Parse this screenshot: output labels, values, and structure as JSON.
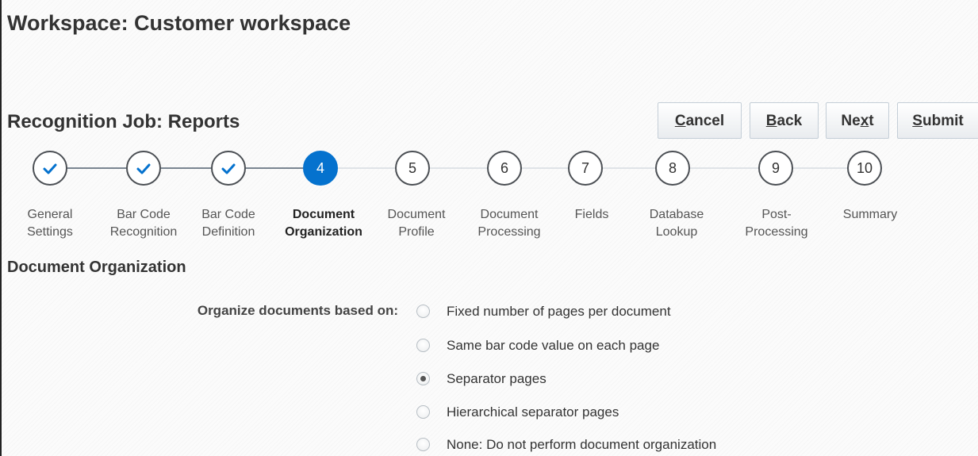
{
  "workspace_title": "Workspace: Customer workspace",
  "job_title": "Recognition Job: Reports",
  "toolbar": {
    "cancel": {
      "accel": "C",
      "rest": "ancel"
    },
    "back": {
      "accel": "B",
      "rest": "ack"
    },
    "next": {
      "pre": "Ne",
      "accel": "x",
      "post": "t"
    },
    "submit": {
      "accel": "S",
      "rest": "ubmit"
    }
  },
  "train": {
    "steps": [
      {
        "number": "1",
        "label": "General\nSettings",
        "state": "done"
      },
      {
        "number": "2",
        "label": "Bar Code\nRecognition",
        "state": "done"
      },
      {
        "number": "3",
        "label": "Bar Code\nDefinition",
        "state": "done"
      },
      {
        "number": "4",
        "label": "Document\nOrganization",
        "state": "current"
      },
      {
        "number": "5",
        "label": "Document\nProfile",
        "state": "todo"
      },
      {
        "number": "6",
        "label": "Document\nProcessing",
        "state": "todo"
      },
      {
        "number": "7",
        "label": "Fields",
        "state": "todo"
      },
      {
        "number": "8",
        "label": "Database\nLookup",
        "state": "todo"
      },
      {
        "number": "9",
        "label": "Post-\nProcessing",
        "state": "todo"
      },
      {
        "number": "10",
        "label": "Summary",
        "state": "todo"
      }
    ]
  },
  "section": {
    "title": "Document Organization",
    "field_label": "Organize documents based on:",
    "selected_option": "Separator pages",
    "options": [
      "Fixed number of pages per document",
      "Same bar code value on each page",
      "Separator pages",
      "Hierarchical separator pages",
      "None: Do not perform document organization"
    ]
  },
  "colors": {
    "accent": "#0572ce",
    "check": "#0572ce",
    "text": "#333333"
  },
  "icons": {
    "done_step": "check-icon",
    "radio": "radio-icon"
  }
}
